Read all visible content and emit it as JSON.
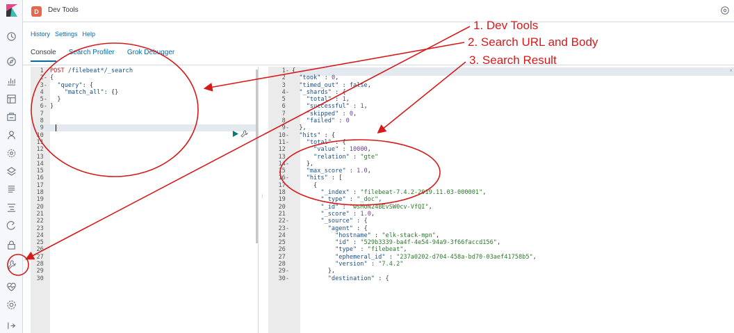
{
  "topbar": {
    "app_badge": "D",
    "title": "Dev Tools"
  },
  "subnav": {
    "history": "History",
    "settings": "Settings",
    "help": "Help"
  },
  "tabs": [
    {
      "label": "Console",
      "active": true
    },
    {
      "label": "Search Profiler",
      "active": false
    },
    {
      "label": "Grok Debugger",
      "active": false
    }
  ],
  "colors": {
    "accent": "#006bb4",
    "annotation": "#d61a1a",
    "badge": "#e7664c"
  },
  "request_lines": [
    {
      "n": "1",
      "fold": "",
      "text": "POST /filebeat*/_search"
    },
    {
      "n": "2",
      "fold": "-",
      "text": "{"
    },
    {
      "n": "3",
      "fold": "-",
      "text": "  \"query\": {"
    },
    {
      "n": "4",
      "fold": "",
      "text": "    \"match_all\": {}"
    },
    {
      "n": "5",
      "fold": "-",
      "text": "  }"
    },
    {
      "n": "6",
      "fold": "-",
      "text": "}"
    },
    {
      "n": "7",
      "fold": "",
      "text": ""
    },
    {
      "n": "8",
      "fold": "",
      "text": ""
    },
    {
      "n": "9",
      "fold": "",
      "text": ""
    },
    {
      "n": "10",
      "fold": "",
      "text": ""
    },
    {
      "n": "11",
      "fold": "",
      "text": ""
    },
    {
      "n": "12",
      "fold": "",
      "text": ""
    },
    {
      "n": "13",
      "fold": "",
      "text": ""
    },
    {
      "n": "14",
      "fold": "",
      "text": ""
    },
    {
      "n": "15",
      "fold": "",
      "text": ""
    },
    {
      "n": "16",
      "fold": "",
      "text": ""
    },
    {
      "n": "17",
      "fold": "",
      "text": ""
    },
    {
      "n": "18",
      "fold": "",
      "text": ""
    },
    {
      "n": "19",
      "fold": "",
      "text": ""
    },
    {
      "n": "20",
      "fold": "",
      "text": ""
    },
    {
      "n": "21",
      "fold": "",
      "text": ""
    },
    {
      "n": "22",
      "fold": "",
      "text": ""
    },
    {
      "n": "23",
      "fold": "",
      "text": ""
    },
    {
      "n": "24",
      "fold": "",
      "text": ""
    },
    {
      "n": "25",
      "fold": "",
      "text": ""
    },
    {
      "n": "26",
      "fold": "",
      "text": ""
    },
    {
      "n": "27",
      "fold": "",
      "text": ""
    },
    {
      "n": "28",
      "fold": "",
      "text": ""
    },
    {
      "n": "29",
      "fold": "",
      "text": ""
    },
    {
      "n": "30",
      "fold": "",
      "text": ""
    }
  ],
  "response_lines": [
    {
      "n": "1",
      "fold": "-",
      "text": "{"
    },
    {
      "n": "2",
      "fold": "",
      "text": "  \"took\" : 0,"
    },
    {
      "n": "3",
      "fold": "",
      "text": "  \"timed_out\" : false,"
    },
    {
      "n": "4",
      "fold": "-",
      "text": "  \"_shards\" : {"
    },
    {
      "n": "5",
      "fold": "",
      "text": "    \"total\" : 1,"
    },
    {
      "n": "6",
      "fold": "",
      "text": "    \"successful\" : 1,"
    },
    {
      "n": "7",
      "fold": "",
      "text": "    \"skipped\" : 0,"
    },
    {
      "n": "8",
      "fold": "",
      "text": "    \"failed\" : 0"
    },
    {
      "n": "9",
      "fold": "-",
      "text": "  },"
    },
    {
      "n": "10",
      "fold": "-",
      "text": "  \"hits\" : {"
    },
    {
      "n": "11",
      "fold": "-",
      "text": "    \"total\" : {"
    },
    {
      "n": "12",
      "fold": "",
      "text": "      \"value\" : 10000,"
    },
    {
      "n": "13",
      "fold": "",
      "text": "      \"relation\" : \"gte\""
    },
    {
      "n": "14",
      "fold": "-",
      "text": "    },"
    },
    {
      "n": "15",
      "fold": "",
      "text": "    \"max_score\" : 1.0,"
    },
    {
      "n": "16",
      "fold": "-",
      "text": "    \"hits\" : ["
    },
    {
      "n": "17",
      "fold": "-",
      "text": "      {"
    },
    {
      "n": "18",
      "fold": "",
      "text": "        \"_index\" : \"filebeat-7.4.2-2019.11.03-000001\","
    },
    {
      "n": "19",
      "fold": "",
      "text": "        \"_type\" : \"_doc\","
    },
    {
      "n": "20",
      "fold": "",
      "text": "        \"_id\" : \"wsMoN24BEvSW0cv-VfQI\","
    },
    {
      "n": "21",
      "fold": "",
      "text": "        \"_score\" : 1.0,"
    },
    {
      "n": "22",
      "fold": "-",
      "text": "        \"_source\" : {"
    },
    {
      "n": "23",
      "fold": "-",
      "text": "          \"agent\" : {"
    },
    {
      "n": "24",
      "fold": "",
      "text": "            \"hostname\" : \"elk-stack-mpn\","
    },
    {
      "n": "25",
      "fold": "",
      "text": "            \"id\" : \"529b3339-ba4f-4e54-94a9-3f66faccd156\","
    },
    {
      "n": "26",
      "fold": "",
      "text": "            \"type\" : \"filebeat\","
    },
    {
      "n": "27",
      "fold": "",
      "text": "            \"ephemeral_id\" : \"237a0202-d704-458a-bd70-03aef41758b5\","
    },
    {
      "n": "28",
      "fold": "",
      "text": "            \"version\" : \"7.4.2\""
    },
    {
      "n": "29",
      "fold": "-",
      "text": "          },"
    },
    {
      "n": "30",
      "fold": "-",
      "text": "          \"destination\" : {"
    }
  ],
  "annotations": [
    {
      "label": "1. Dev Tools"
    },
    {
      "label": "2. Search URL and Body"
    },
    {
      "label": "3. Search Result"
    }
  ],
  "icons": {
    "rail": [
      "kibana-logo-icon",
      "clock-icon",
      "compass-icon",
      "visualize-icon",
      "dashboard-icon",
      "canvas-icon",
      "users-icon",
      "ml-icon",
      "infrastructure-icon",
      "logs-icon",
      "apm-icon",
      "uptime-icon",
      "siem-icon",
      "dev-tools-icon",
      "monitoring-icon",
      "management-icon",
      "collapse-icon"
    ],
    "editor": [
      "play-icon",
      "wrench-icon"
    ]
  }
}
